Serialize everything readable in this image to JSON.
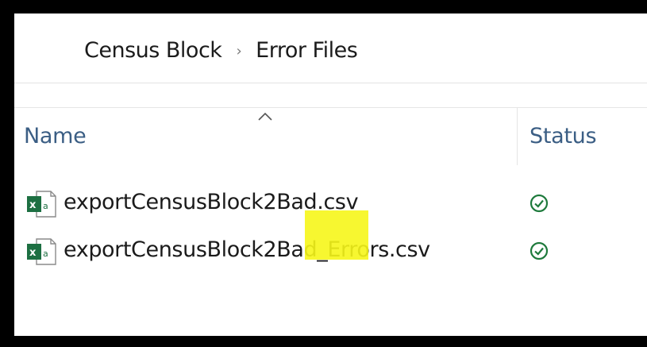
{
  "breadcrumb": {
    "items": [
      "Census Block",
      "Error Files"
    ],
    "separator": "›"
  },
  "columns": {
    "name": "Name",
    "status": "Status"
  },
  "files": [
    {
      "name": "exportCensusBlock2Bad.csv",
      "icon": "excel-csv-file-icon",
      "status_icon": "synced-check-icon"
    },
    {
      "name": "exportCensusBlock2Bad_Errors.csv",
      "icon": "excel-csv-file-icon",
      "status_icon": "synced-check-icon"
    }
  ],
  "colors": {
    "status_green": "#1e7a3c",
    "excel_green": "#1d6f42",
    "highlight": "#f6f61a",
    "header_text": "#3b5e84"
  }
}
